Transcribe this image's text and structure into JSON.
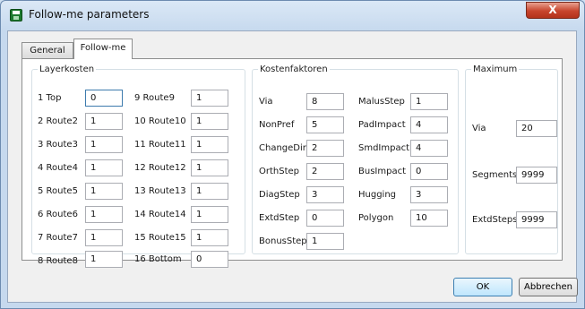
{
  "window": {
    "title": "Follow-me parameters",
    "close_glyph": "X"
  },
  "tabs": [
    {
      "label": "General"
    },
    {
      "label": "Follow-me"
    }
  ],
  "layerkosten": {
    "legend": "Layerkosten",
    "items": [
      {
        "label": "1 Top",
        "value": "0"
      },
      {
        "label": "2 Route2",
        "value": "1"
      },
      {
        "label": "3 Route3",
        "value": "1"
      },
      {
        "label": "4 Route4",
        "value": "1"
      },
      {
        "label": "5 Route5",
        "value": "1"
      },
      {
        "label": "6 Route6",
        "value": "1"
      },
      {
        "label": "7 Route7",
        "value": "1"
      },
      {
        "label": "8 Route8",
        "value": "1"
      },
      {
        "label": "9 Route9",
        "value": "1"
      },
      {
        "label": "10 Route10",
        "value": "1"
      },
      {
        "label": "11 Route11",
        "value": "1"
      },
      {
        "label": "12 Route12",
        "value": "1"
      },
      {
        "label": "13 Route13",
        "value": "1"
      },
      {
        "label": "14 Route14",
        "value": "1"
      },
      {
        "label": "15 Route15",
        "value": "1"
      },
      {
        "label": "16 Bottom",
        "value": "0"
      }
    ]
  },
  "kostenfaktoren": {
    "legend": "Kostenfaktoren",
    "items": [
      {
        "label": "Via",
        "value": "8"
      },
      {
        "label": "NonPref",
        "value": "5"
      },
      {
        "label": "ChangeDir",
        "value": "2"
      },
      {
        "label": "OrthStep",
        "value": "2"
      },
      {
        "label": "DiagStep",
        "value": "3"
      },
      {
        "label": "ExtdStep",
        "value": "0"
      },
      {
        "label": "BonusStep",
        "value": "1"
      },
      {
        "label": "MalusStep",
        "value": "1"
      },
      {
        "label": "PadImpact",
        "value": "4"
      },
      {
        "label": "SmdImpact",
        "value": "4"
      },
      {
        "label": "BusImpact",
        "value": "0"
      },
      {
        "label": "Hugging",
        "value": "3"
      },
      {
        "label": "Polygon",
        "value": "10"
      }
    ]
  },
  "maximum": {
    "legend": "Maximum",
    "items": [
      {
        "label": "Via",
        "value": "20"
      },
      {
        "label": "Segments",
        "value": "9999"
      },
      {
        "label": "ExtdSteps",
        "value": "9999"
      }
    ]
  },
  "buttons": {
    "ok": "OK",
    "cancel": "Abbrechen"
  }
}
